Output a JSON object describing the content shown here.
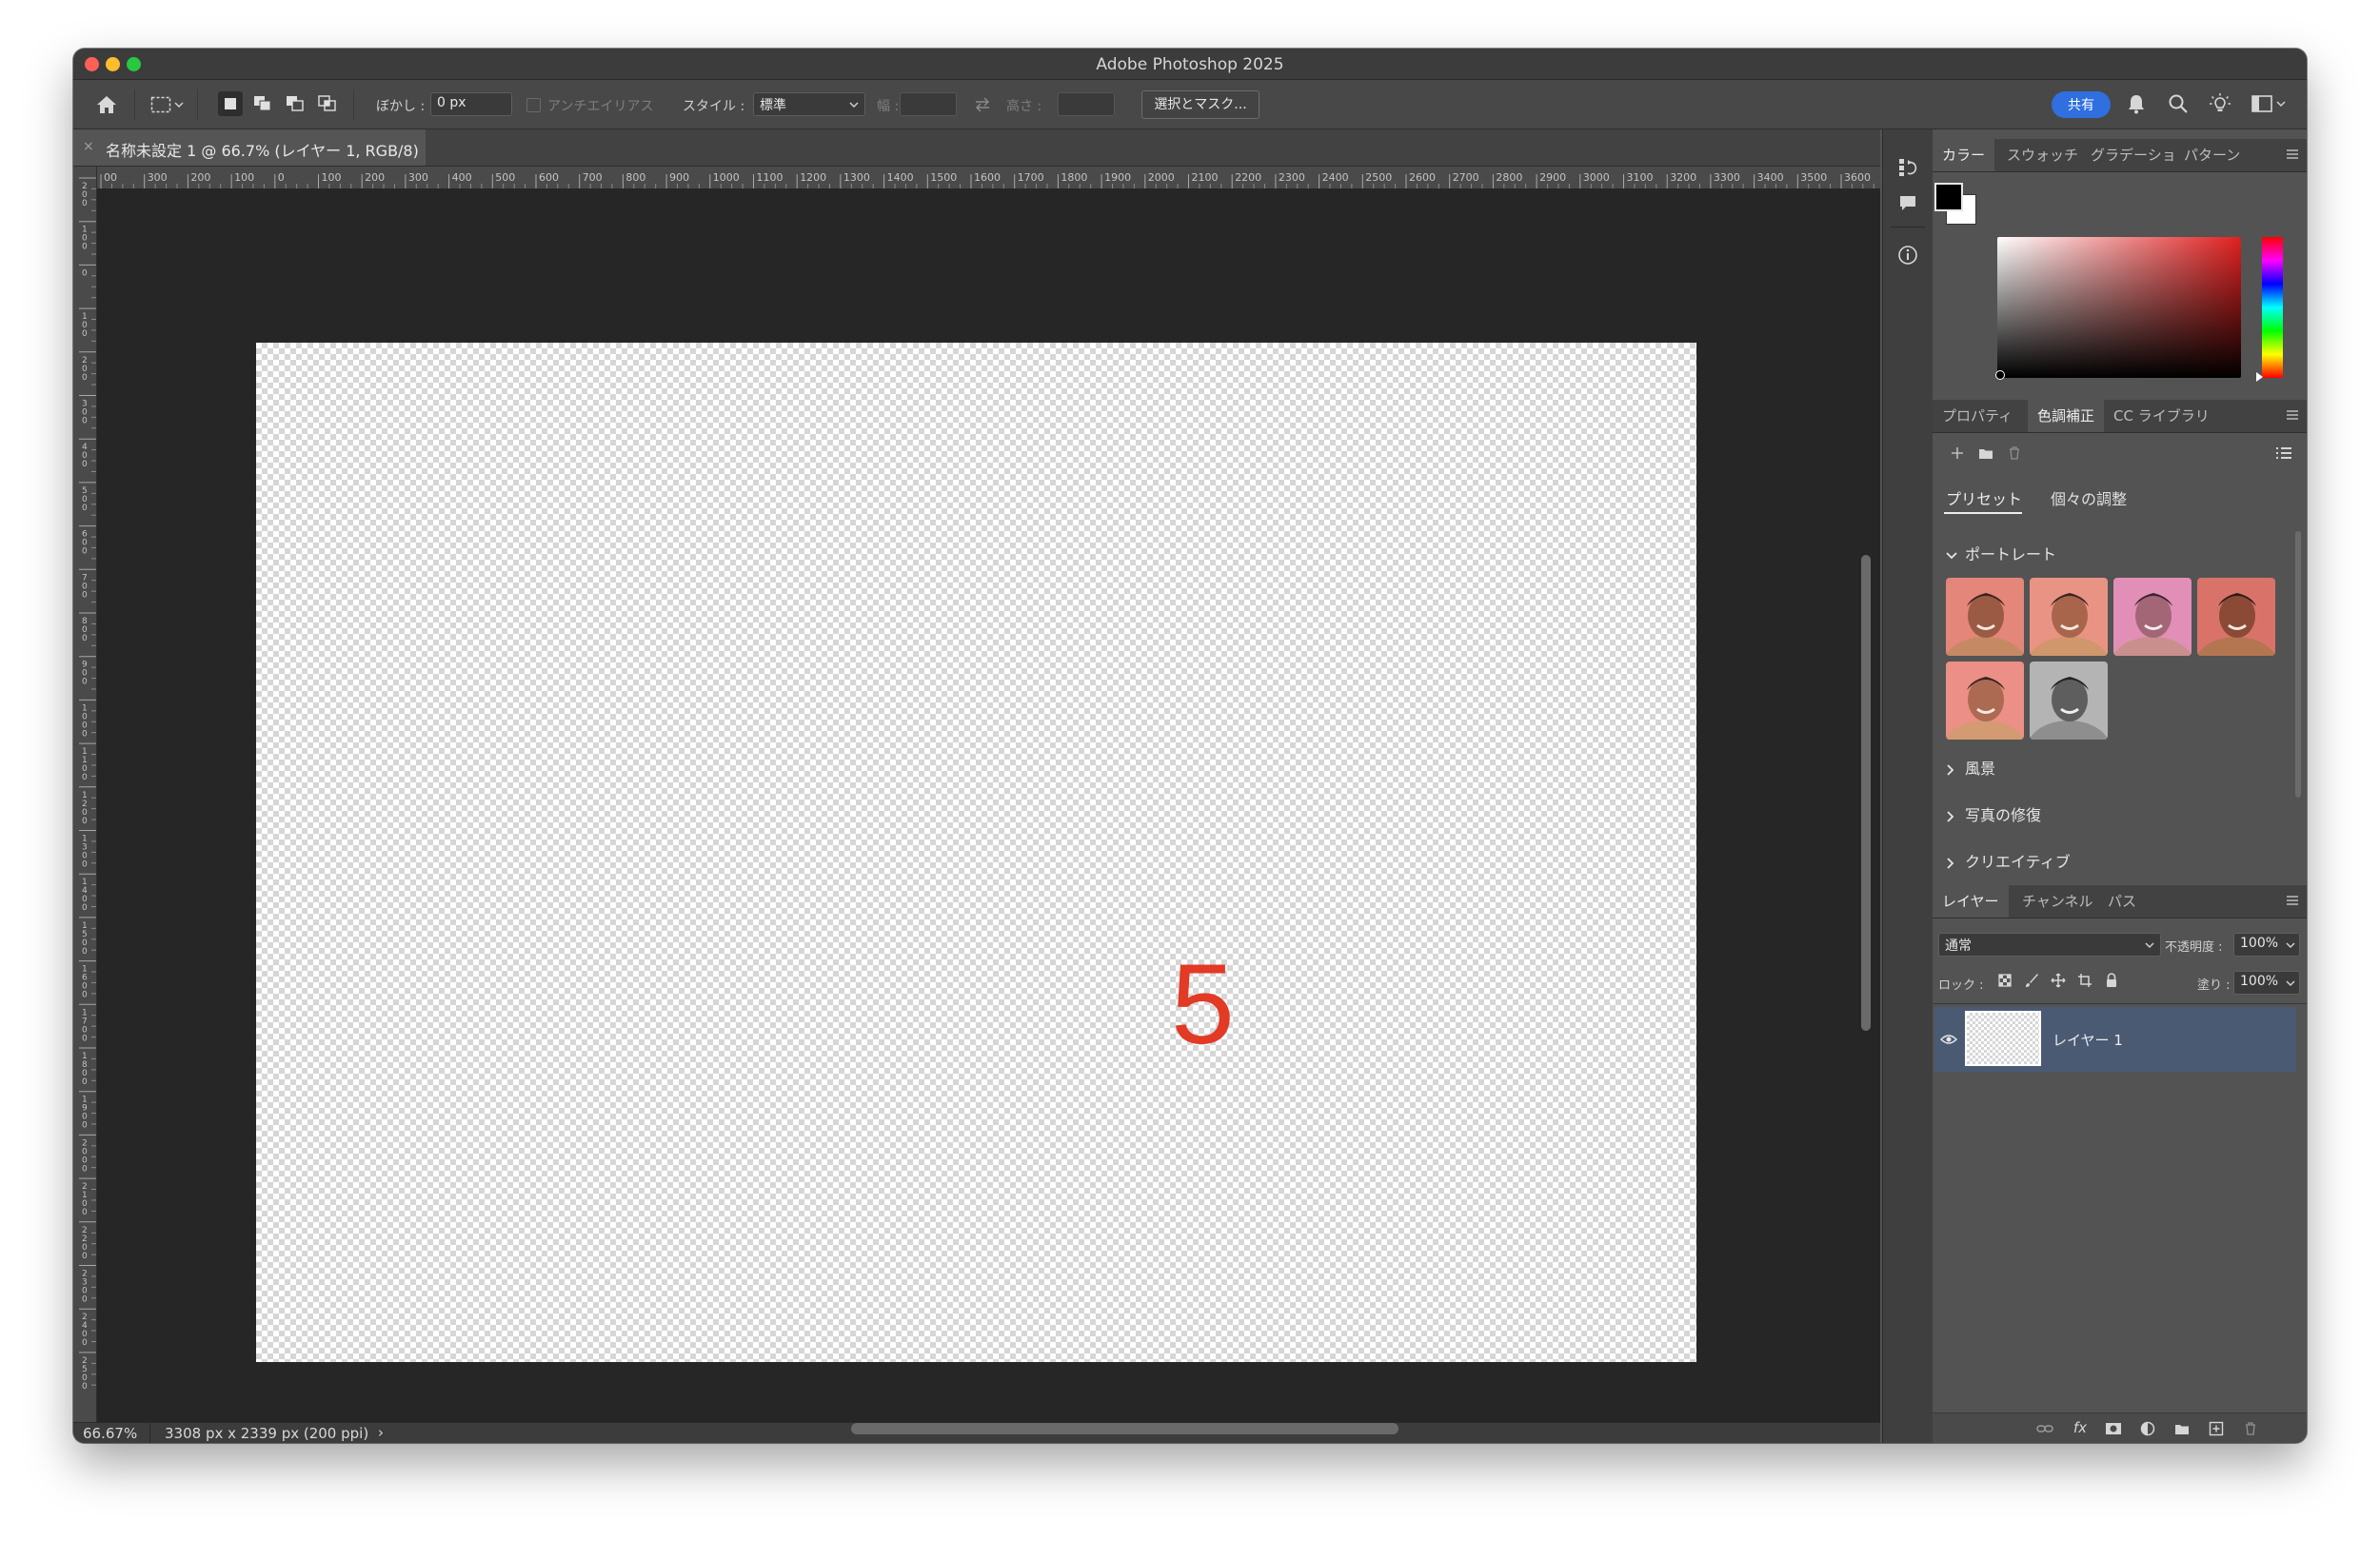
{
  "window": {
    "title": "Adobe Photoshop 2025"
  },
  "options_bar": {
    "feather_label": "ぼかし :",
    "feather_value": "0 px",
    "antialias_label": "アンチエイリアス",
    "style_label": "スタイル :",
    "style_value": "標準",
    "width_label": "幅 :",
    "height_label": "高さ :",
    "select_mask_button": "選択とマスク...",
    "share_button": "共有"
  },
  "document_tab": {
    "title": "名称未設定 1 @ 66.7% (レイヤー 1, RGB/8)",
    "close": "×"
  },
  "ruler": {
    "h_ticks": [
      "00",
      "300",
      "200",
      "100",
      "0",
      "100",
      "200",
      "300",
      "400",
      "500",
      "600",
      "700",
      "800",
      "900",
      "1000",
      "1100",
      "1200",
      "1300",
      "1400",
      "1500",
      "1600",
      "1700",
      "1800",
      "1900",
      "2000",
      "2100",
      "2200",
      "2300",
      "2400",
      "2500",
      "2600",
      "2700",
      "2800",
      "2900",
      "3000",
      "3100",
      "3200",
      "3300",
      "3400",
      "3500",
      "3600"
    ],
    "v_ticks": [
      "200",
      "100",
      "0",
      "100",
      "200",
      "300",
      "400",
      "500",
      "600",
      "700",
      "800",
      "900",
      "1000",
      "1100",
      "1200",
      "1300",
      "1400",
      "1500",
      "1600",
      "1700",
      "1800",
      "1900",
      "2000",
      "2100",
      "2200",
      "2300",
      "2400",
      "2500"
    ]
  },
  "canvas": {
    "annotation": "5",
    "annotation_color": "#e23a24"
  },
  "status_bar": {
    "zoom": "66.67%",
    "doc_info": "3308 px x 2339 px (200 ppi)",
    "arrow": "›"
  },
  "color_panel": {
    "tabs": [
      "カラー",
      "スウォッチ",
      "グラデーショ",
      "パターン"
    ],
    "foreground": "#000000",
    "background": "#ffffff",
    "hue_color": "#e02020"
  },
  "adjust_panel": {
    "tabs": [
      "プロパティ",
      "色調補正",
      "CC ライブラリ"
    ],
    "subtabs": [
      "プリセット",
      "個々の調整"
    ],
    "sections": [
      {
        "label": "ポートレート",
        "expanded": true
      },
      {
        "label": "風景",
        "expanded": false
      },
      {
        "label": "写真の修復",
        "expanded": false
      },
      {
        "label": "クリエイティブ",
        "expanded": false
      }
    ],
    "expanded_icon": "chevron-down-icon",
    "collapsed_icon": "chevron-right-icon"
  },
  "layers_panel": {
    "tabs": [
      "レイヤー",
      "チャンネル",
      "パス"
    ],
    "blend_mode": "通常",
    "opacity_label": "不透明度 :",
    "opacity_value": "100%",
    "lock_label": "ロック :",
    "fill_label": "塗り :",
    "fill_value": "100%",
    "layers": [
      {
        "name": "レイヤー 1",
        "visible": true,
        "selected": true
      }
    ],
    "selected_color": "#4b5a73",
    "footer_icons": [
      "link-icon",
      "fx-icon",
      "mask-icon",
      "adjustment-icon",
      "folder-icon",
      "new-layer-icon",
      "trash-icon"
    ],
    "fx_label": "fx"
  }
}
